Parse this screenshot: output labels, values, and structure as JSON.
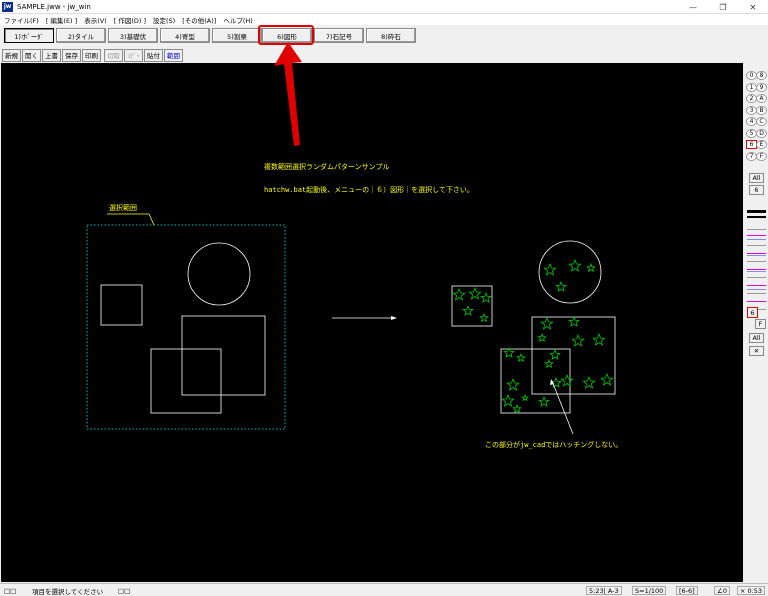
{
  "window": {
    "title": "SAMPLE.jww - jw_win",
    "icon_text": "jw"
  },
  "menu": [
    "ファイル(F)",
    "[ 編集(E) ]",
    "表示(V)",
    "[ 作図(D) ]",
    "設定(S)",
    "[その他(A)]",
    "ヘルプ(H)"
  ],
  "tabs": [
    {
      "label": "1)ホﾞーﾀﾞ",
      "active": true
    },
    {
      "label": "2)タイル"
    },
    {
      "label": "3)基礎伏"
    },
    {
      "label": "4)寄型"
    },
    {
      "label": "5)割栗"
    },
    {
      "label": "6)図形"
    },
    {
      "label": "7)石記号"
    },
    {
      "label": "8)砕石"
    }
  ],
  "toolbar": [
    "新規",
    "開く",
    "上書",
    "保存",
    "印刷",
    "切取",
    "ｺﾋﾟｰ",
    "貼付",
    "範囲"
  ],
  "canvas": {
    "title": "複数範囲選択ランダムパターンサンプル",
    "instruction": "hatchw.bat起動後、メニューの｜６）図形｜を選択して下さい。",
    "range_label": "選択範囲",
    "note": "この部分がjw_cadではハッチングしない。"
  },
  "right_panel": {
    "layers_left": [
      "0",
      "1",
      "2",
      "3",
      "4",
      "5",
      "6",
      "7"
    ],
    "layers_right": [
      "8",
      "9",
      "A",
      "B",
      "C",
      "D",
      "E",
      "F"
    ],
    "all_label": "All",
    "group_num": "6",
    "layer_num": "6",
    "f_label": "F",
    "all2_label": "All",
    "x_label": "✕"
  },
  "status": {
    "left1": "□□",
    "message": "項目を選択してください",
    "left2": "□□",
    "coord": "5:23| A-3",
    "scale": "S=1/100",
    "layer": "[6-6]",
    "angle": "∠0",
    "ratio": "× 0.53"
  },
  "colors": {
    "canvas_bg": "#000000",
    "yellow_text": "#ffff00",
    "cyan_dotted": "#00c0c0",
    "star_green": "#00cc00",
    "star_fill": "#8000c0",
    "arrow_red": "#e00000"
  }
}
